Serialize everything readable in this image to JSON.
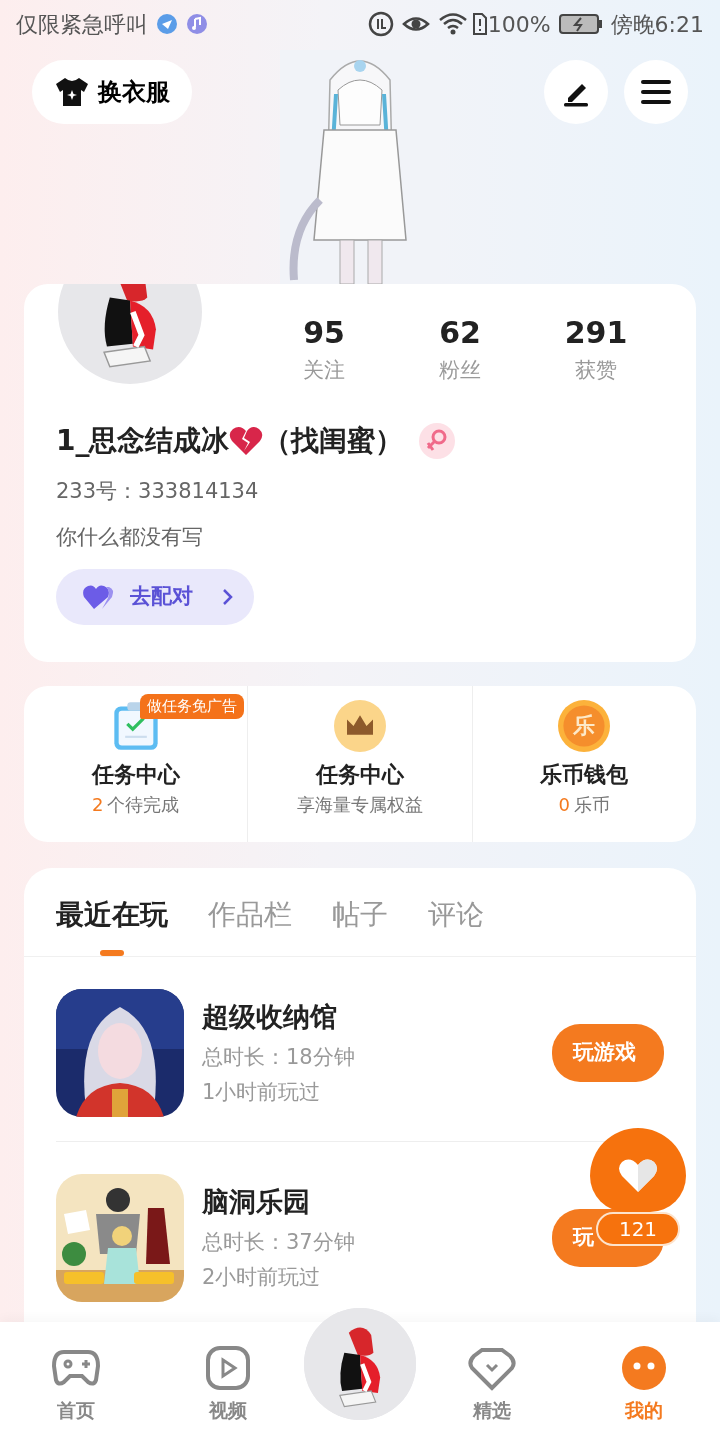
{
  "status_bar": {
    "carrier": "仅限紧急呼叫",
    "battery": "100%",
    "time": "傍晚6:21"
  },
  "outfit_button": {
    "label": "换衣服"
  },
  "profile": {
    "stats": [
      {
        "value": "95",
        "label": "关注"
      },
      {
        "value": "62",
        "label": "粉丝"
      },
      {
        "value": "291",
        "label": "获赞"
      }
    ],
    "name_prefix": "1_思念结成冰",
    "name_suffix": "（找闺蜜）",
    "female": true,
    "account": "233号：333814134",
    "bio": "你什么都没有写",
    "match_button": "去配对"
  },
  "tasks": [
    {
      "kind": "clipboard",
      "badge": "做任务免广告",
      "title": "任务中心",
      "count": "2",
      "sub": "个待完成"
    },
    {
      "kind": "crown",
      "title": "任务中心",
      "sub": "享海量专属权益"
    },
    {
      "kind": "coin",
      "icon_text": "乐",
      "title": "乐币钱包",
      "count": "0",
      "sub": "乐币"
    }
  ],
  "tabs": [
    {
      "label": "最近在玩",
      "selected": true
    },
    {
      "label": "作品栏",
      "selected": false
    },
    {
      "label": "帖子",
      "selected": false
    },
    {
      "label": "评论",
      "selected": false
    }
  ],
  "games": [
    {
      "title": "超级收纳馆",
      "duration": "总时长：18分钟",
      "last_played": "1小时前玩过",
      "button": "玩游戏"
    },
    {
      "title": "脑洞乐园",
      "duration": "总时长：37分钟",
      "last_played": "2小时前玩过",
      "button": "玩"
    }
  ],
  "floating_like": {
    "count": "121"
  },
  "bottom_nav": [
    {
      "kind": "gamepad",
      "label": "首页",
      "selected": false
    },
    {
      "kind": "play",
      "label": "视频",
      "selected": false
    },
    {
      "kind": "center"
    },
    {
      "kind": "heart",
      "label": "精选",
      "selected": false
    },
    {
      "kind": "face",
      "label": "我的",
      "selected": true
    }
  ]
}
